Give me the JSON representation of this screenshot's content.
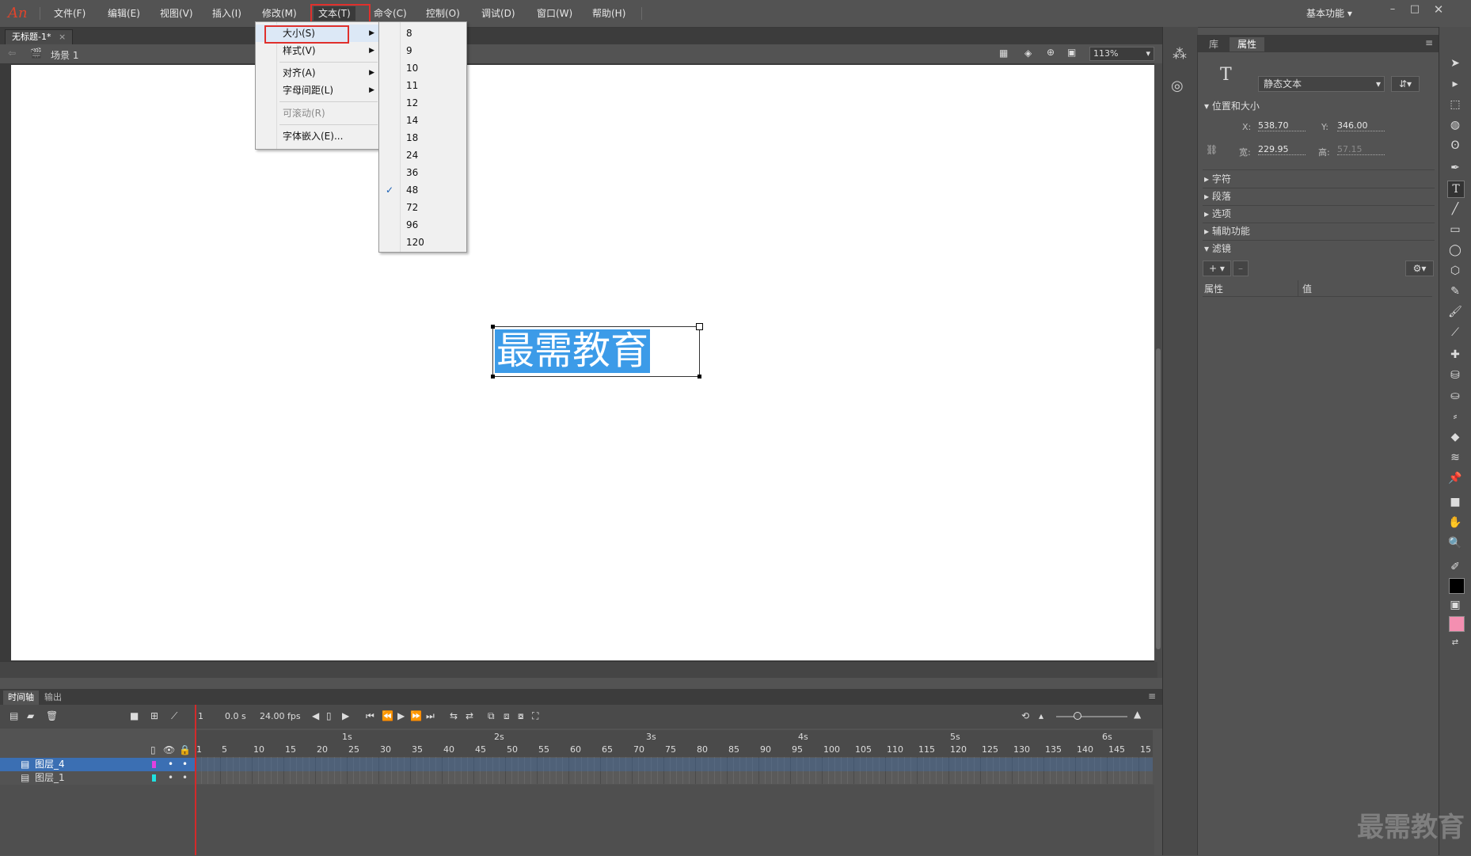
{
  "app": {
    "logo": "An",
    "workspace": "基本功能"
  },
  "menubar": [
    "文件(F)",
    "编辑(E)",
    "视图(V)",
    "插入(I)",
    "修改(M)",
    "文本(T)",
    "命令(C)",
    "控制(O)",
    "调试(D)",
    "窗口(W)",
    "帮助(H)"
  ],
  "document": {
    "tab": "无标题-1*",
    "scene": "场景 1",
    "zoom": "113%"
  },
  "stage": {
    "text": "最需教育"
  },
  "text_menu": {
    "size": "大小(S)",
    "style": "样式(V)",
    "align": "对齐(A)",
    "tracking": "字母间距(L)",
    "scrollable": "可滚动(R)",
    "embed": "字体嵌入(E)..."
  },
  "size_submenu": {
    "options": [
      "8",
      "9",
      "10",
      "11",
      "12",
      "14",
      "18",
      "24",
      "36",
      "48",
      "72",
      "96",
      "120"
    ],
    "checked": "48"
  },
  "properties": {
    "tab_library": "库",
    "tab_properties": "属性",
    "text_type": "静态文本",
    "position_size": "位置和大小",
    "x_label": "X:",
    "x_value": "538.70",
    "y_label": "Y:",
    "y_value": "346.00",
    "w_label": "宽:",
    "w_value": "229.95",
    "h_label": "高:",
    "h_value": "57.15",
    "sections": [
      "字符",
      "段落",
      "选项",
      "辅助功能"
    ],
    "filters": "滤镜",
    "col_attr": "属性",
    "col_value": "值"
  },
  "timeline": {
    "tab_timeline": "时间轴",
    "tab_output": "输出",
    "frame": "1",
    "time": "0.0 s",
    "fps": "24.00 fps",
    "layers": [
      "图层_4",
      "图层_1"
    ],
    "seconds": [
      "1s",
      "2s",
      "3s",
      "4s",
      "5s",
      "6s"
    ],
    "ticks": [
      "1",
      "5",
      "10",
      "15",
      "20",
      "25",
      "30",
      "35",
      "40",
      "45",
      "50",
      "55",
      "60",
      "65",
      "70",
      "75",
      "80",
      "85",
      "90",
      "95",
      "100",
      "105",
      "110",
      "115",
      "120",
      "125",
      "130",
      "135",
      "140",
      "145",
      "15"
    ],
    "layer_colors": [
      "#e040e0",
      "#20e0e0"
    ]
  },
  "watermark": "最需教育"
}
